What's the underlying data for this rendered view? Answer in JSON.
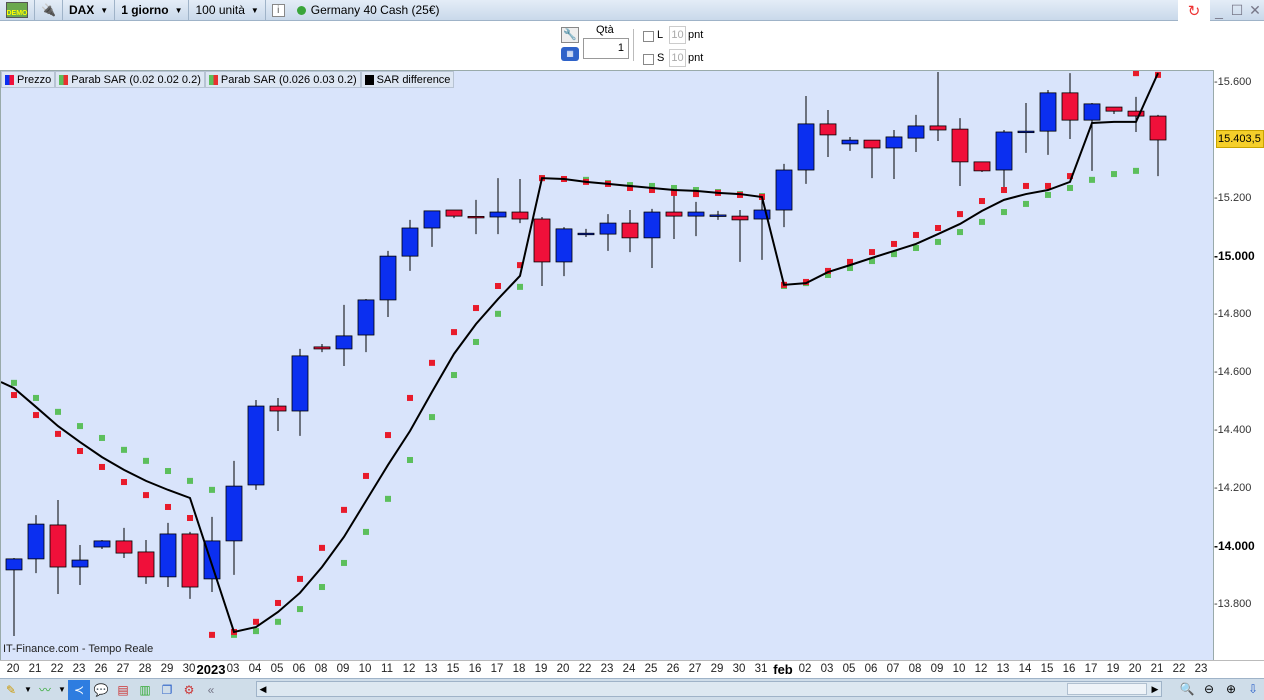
{
  "toolbar": {
    "demo_badge": "DEMO",
    "symbol": "DAX",
    "timeframe": "1 giorno",
    "quantity_units": "100 unità",
    "info": "i",
    "instrument": "Germany 40 Cash (25€)",
    "status_color": "#3aa53a"
  },
  "order": {
    "qty_label": "Qtà",
    "qty_value": "1",
    "long_label": "L",
    "short_label": "S",
    "long_points": "10",
    "short_points": "10",
    "points_unit": "pnt"
  },
  "legend": [
    {
      "label": "Prezzo",
      "colors": [
        "#0b2ff0",
        "#f0103a"
      ]
    },
    {
      "label": "Parab SAR (0.02 0.02 0.2)",
      "colors": [
        "#5cbf5c",
        "#e83030"
      ]
    },
    {
      "label": "Parab SAR (0.026 0.03 0.2)",
      "colors": [
        "#5cbf5c",
        "#e83030"
      ]
    },
    {
      "label": "SAR difference",
      "colors": [
        "#000000",
        "#000000"
      ]
    }
  ],
  "watermark": "IT-Finance.com - Tempo Reale",
  "current_price": "15.403,5",
  "chart_data": {
    "type": "candlestick",
    "y_ticks": [
      {
        "value": 15600,
        "label": "15.600",
        "bold": false
      },
      {
        "value": 15200,
        "label": "15.200",
        "bold": false
      },
      {
        "value": 15000,
        "label": "15.000",
        "bold": true
      },
      {
        "value": 14800,
        "label": "14.800",
        "bold": false
      },
      {
        "value": 14600,
        "label": "14.600",
        "bold": false
      },
      {
        "value": 14400,
        "label": "14.400",
        "bold": false
      },
      {
        "value": 14200,
        "label": "14.200",
        "bold": false
      },
      {
        "value": 14000,
        "label": "14.000",
        "bold": true
      },
      {
        "value": 13800,
        "label": "13.800",
        "bold": false
      }
    ],
    "ylim": [
      13600,
      15640
    ],
    "x_labels": [
      "20",
      "21",
      "22",
      "23",
      "26",
      "27",
      "28",
      "29",
      "30",
      "2023",
      "03",
      "04",
      "05",
      "06",
      "08",
      "09",
      "10",
      "11",
      "12",
      "13",
      "15",
      "16",
      "17",
      "18",
      "19",
      "20",
      "22",
      "23",
      "24",
      "25",
      "26",
      "27",
      "29",
      "30",
      "31",
      "feb",
      "02",
      "03",
      "05",
      "06",
      "07",
      "08",
      "09",
      "10",
      "12",
      "13",
      "14",
      "15",
      "16",
      "17",
      "19",
      "20",
      "21",
      "22",
      "23"
    ],
    "x_bold_labels": [
      "2023",
      "feb"
    ],
    "colors": {
      "up": "#0b2ff0",
      "down": "#f0103a",
      "sar_a": "#e81b2b",
      "sar_b": "#5cbf5c",
      "difference": "#000000"
    },
    "ohlc": [
      [
        13921,
        13962,
        13693,
        13959
      ],
      [
        13959,
        14110,
        13910,
        14079
      ],
      [
        14076,
        14162,
        13838,
        13931
      ],
      [
        13931,
        14007,
        13869,
        13955
      ],
      [
        14000,
        14024,
        13993,
        14021
      ],
      [
        14021,
        14066,
        13962,
        13979
      ],
      [
        13983,
        14024,
        13873,
        13897
      ],
      [
        13897,
        14083,
        13862,
        14045
      ],
      [
        14045,
        14052,
        13821,
        13862
      ],
      [
        13890,
        14104,
        13845,
        14021
      ],
      [
        14021,
        14297,
        13904,
        14210
      ],
      [
        14214,
        14507,
        14197,
        14486
      ],
      [
        14486,
        14514,
        14400,
        14469
      ],
      [
        14469,
        14683,
        14383,
        14659
      ],
      [
        14690,
        14700,
        14672,
        14683
      ],
      [
        14683,
        14835,
        14624,
        14728
      ],
      [
        14731,
        14855,
        14672,
        14852
      ],
      [
        14852,
        15021,
        14793,
        15003
      ],
      [
        15003,
        15128,
        14952,
        15100
      ],
      [
        15100,
        15159,
        15035,
        15159
      ],
      [
        15162,
        15162,
        15134,
        15141
      ],
      [
        15140,
        15197,
        15079,
        15138
      ],
      [
        15138,
        15272,
        15079,
        15155
      ],
      [
        15155,
        15269,
        15117,
        15131
      ],
      [
        15131,
        15138,
        14900,
        14983
      ],
      [
        14983,
        15103,
        14934,
        15097
      ],
      [
        15079,
        15097,
        15069,
        15082
      ],
      [
        15079,
        15148,
        15021,
        15117
      ],
      [
        15117,
        15162,
        15017,
        15066
      ],
      [
        15066,
        15166,
        14962,
        15155
      ],
      [
        15155,
        15217,
        15062,
        15141
      ],
      [
        15141,
        15190,
        15072,
        15155
      ],
      [
        15145,
        15159,
        15128,
        15145
      ],
      [
        15141,
        15162,
        14983,
        15128
      ],
      [
        15131,
        15210,
        14990,
        15162
      ],
      [
        15162,
        15321,
        15103,
        15300
      ],
      [
        15300,
        15555,
        15252,
        15459
      ],
      [
        15459,
        15507,
        15345,
        15421
      ],
      [
        15390,
        15414,
        15366,
        15403
      ],
      [
        15403,
        15403,
        15272,
        15376
      ],
      [
        15376,
        15438,
        15269,
        15414
      ],
      [
        15410,
        15490,
        15362,
        15452
      ],
      [
        15452,
        15638,
        15400,
        15438
      ],
      [
        15441,
        15479,
        15245,
        15328
      ],
      [
        15328,
        15328,
        15293,
        15297
      ],
      [
        15300,
        15438,
        15241,
        15431
      ],
      [
        15431,
        15531,
        15359,
        15434
      ],
      [
        15434,
        15576,
        15352,
        15566
      ],
      [
        15566,
        15634,
        15407,
        15472
      ],
      [
        15472,
        15531,
        15297,
        15528
      ],
      [
        15517,
        15517,
        15493,
        15503
      ],
      [
        15503,
        15552,
        15431,
        15486
      ],
      [
        15486,
        15490,
        15279,
        15403.5
      ]
    ],
    "sar_a": [
      14524,
      14455,
      14390,
      14331,
      14276,
      14224,
      14179,
      14138,
      14100,
      13697,
      13707,
      13742,
      13807,
      13890,
      13997,
      14128,
      14245,
      14386,
      14514,
      14635,
      14741,
      14824,
      14900,
      14972,
      15272,
      15269,
      15259,
      15252,
      15238,
      15231,
      15221,
      15217,
      15221,
      15214,
      15207,
      14904,
      14914,
      14952,
      14983,
      15017,
      15045,
      15076,
      15100,
      15148,
      15193,
      15231,
      15245,
      15245,
      15279,
      15641,
      15641,
      15634,
      15628
    ],
    "sar_b": [
      14566,
      14514,
      14466,
      14417,
      14376,
      14335,
      14297,
      14262,
      14228,
      14197,
      13697,
      13710,
      13742,
      13786,
      13862,
      13945,
      14052,
      14166,
      14300,
      14448,
      14593,
      14707,
      14804,
      14897,
      15272,
      15269,
      15266,
      15255,
      15248,
      15245,
      15238,
      15231,
      15224,
      15217,
      15210,
      14900,
      14910,
      14938,
      14962,
      14986,
      15010,
      15031,
      15052,
      15086,
      15121,
      15155,
      15183,
      15214,
      15238,
      15266,
      15286,
      15297,
      null
    ],
    "difference": [
      14548,
      14483,
      14417,
      14362,
      14310,
      14266,
      14228,
      14197,
      14169,
      13938,
      13707,
      13724,
      13776,
      13842,
      13931,
      14035,
      14159,
      14283,
      14400,
      14535,
      14666,
      14769,
      14855,
      14935,
      15272,
      15269,
      15259,
      15252,
      15245,
      15238,
      15231,
      15228,
      15221,
      15217,
      15207,
      14904,
      14910,
      14948,
      14972,
      14997,
      15021,
      15045,
      15079,
      15114,
      15159,
      15197,
      15217,
      15231,
      15259,
      15462,
      15466,
      15466,
      15634
    ]
  }
}
